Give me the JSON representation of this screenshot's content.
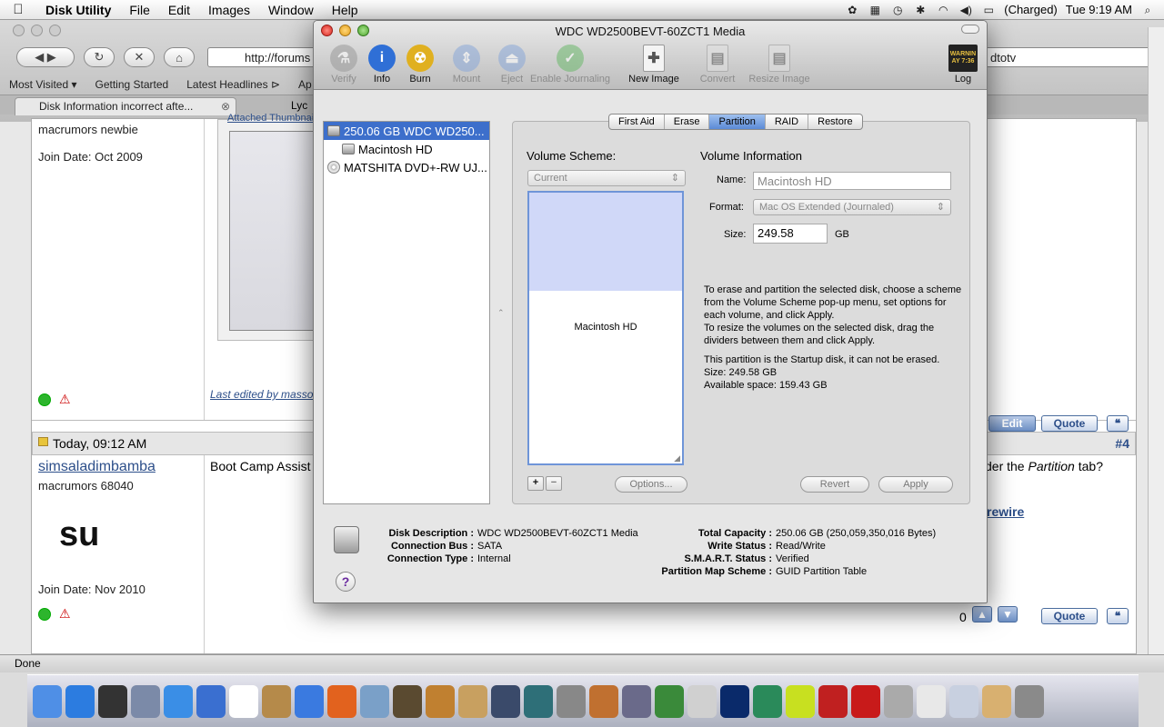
{
  "menubar": {
    "app": "Disk Utility",
    "items": [
      "File",
      "Edit",
      "Images",
      "Window",
      "Help"
    ],
    "battery": "(Charged)",
    "clock": "Tue 9:19 AM"
  },
  "browser": {
    "url": "http://forums",
    "url_tail": "dtotv",
    "bookmarks": [
      "Most Visited ▾",
      "Getting Started",
      "Latest Headlines ⊳",
      "Ap"
    ],
    "tab": "Disk Information incorrect afte...",
    "tab2": "Lyc",
    "status": "Done"
  },
  "forum": {
    "post1": {
      "role": "macrumors newbie",
      "join": "Join Date: Oct 2009",
      "attached": "Attached Thumbnail",
      "edited": "Last edited by masso",
      "edit": "Edit",
      "quote": "Quote"
    },
    "post2": {
      "date": "Today, 09:12 AM",
      "num": "#4",
      "user": "simsaladimbamba",
      "role": "macrumors 68040",
      "avatar": "su",
      "join": "Join Date: Nov 2010",
      "text": "Boot Camp Assist",
      "text_tail_pre": "der the ",
      "text_tail_em": "Partition",
      "text_tail_post": " tab?",
      "link_tail": "rewire",
      "count": "0",
      "quote": "Quote"
    }
  },
  "du": {
    "title": "WDC WD2500BEVT-60ZCT1 Media",
    "toolbar": [
      {
        "label": "Verify",
        "icon": "microscope-icon",
        "disabled": true
      },
      {
        "label": "Info",
        "icon": "info-icon",
        "disabled": false
      },
      {
        "label": "Burn",
        "icon": "burn-icon",
        "disabled": false
      },
      {
        "label": "Mount",
        "icon": "mount-icon",
        "disabled": true
      },
      {
        "label": "Eject",
        "icon": "eject-icon",
        "disabled": true
      },
      {
        "label": "Enable Journaling",
        "icon": "journaling-icon",
        "disabled": true
      },
      {
        "label": "New Image",
        "icon": "new-image-icon",
        "disabled": false
      },
      {
        "label": "Convert",
        "icon": "convert-icon",
        "disabled": true
      },
      {
        "label": "Resize Image",
        "icon": "resize-image-icon",
        "disabled": true
      }
    ],
    "log": {
      "label": "Log",
      "screen": "WARNIN\nAY 7:36"
    },
    "sidebar": [
      "250.06 GB WDC WD250...",
      "Macintosh HD",
      "MATSHITA DVD+-RW UJ..."
    ],
    "tabs": [
      "First Aid",
      "Erase",
      "Partition",
      "RAID",
      "Restore"
    ],
    "volume_scheme": "Volume Scheme:",
    "scheme_value": "Current",
    "partition_label": "Macintosh HD",
    "volume_info": "Volume Information",
    "name_label": "Name:",
    "name_value": "Macintosh HD",
    "format_label": "Format:",
    "format_value": "Mac OS Extended (Journaled)",
    "size_label": "Size:",
    "size_value": "249.58",
    "size_unit": "GB",
    "help1": "To erase and partition the selected disk, choose a scheme from the Volume Scheme pop-up menu, set options for each volume, and click Apply.",
    "help2": "To resize the volumes on the selected disk, drag the dividers between them and click Apply.",
    "help3": "This partition is the Startup disk, it can not be erased.",
    "help4": "Size: 249.58 GB",
    "help5": "Available space: 159.43 GB",
    "plus": "+",
    "minus": "−",
    "options": "Options...",
    "revert": "Revert",
    "apply": "Apply",
    "details_left": [
      [
        "Disk Description :",
        "WDC WD2500BEVT-60ZCT1 Media"
      ],
      [
        "Connection Bus :",
        "SATA"
      ],
      [
        "Connection Type :",
        "Internal"
      ]
    ],
    "details_right": [
      [
        "Total Capacity :",
        "250.06 GB (250,059,350,016 Bytes)"
      ],
      [
        "Write Status :",
        "Read/Write"
      ],
      [
        "S.M.A.R.T. Status :",
        "Verified"
      ],
      [
        "Partition Map Scheme :",
        "GUID Partition Table"
      ]
    ],
    "help_button": "?"
  },
  "dock": [
    "finder",
    "app-store",
    "dashboard",
    "mail-stamp",
    "safari",
    "facetime",
    "ical",
    "photo",
    "itunes",
    "firefox",
    "iphoto",
    "imovie",
    "garageband",
    "preview",
    "expose",
    "time-machine",
    "system-prefs",
    "keynote",
    "pixelmator",
    "numbers",
    "pages",
    "photoshop",
    "dreamweaver",
    "fireworks",
    "flash",
    "acrobat",
    "disk-utility",
    "documents",
    "downloads",
    "folder",
    "trash"
  ],
  "colors": {
    "selection": "#3d6fcb",
    "partition_fill": "#d0d8f8"
  }
}
